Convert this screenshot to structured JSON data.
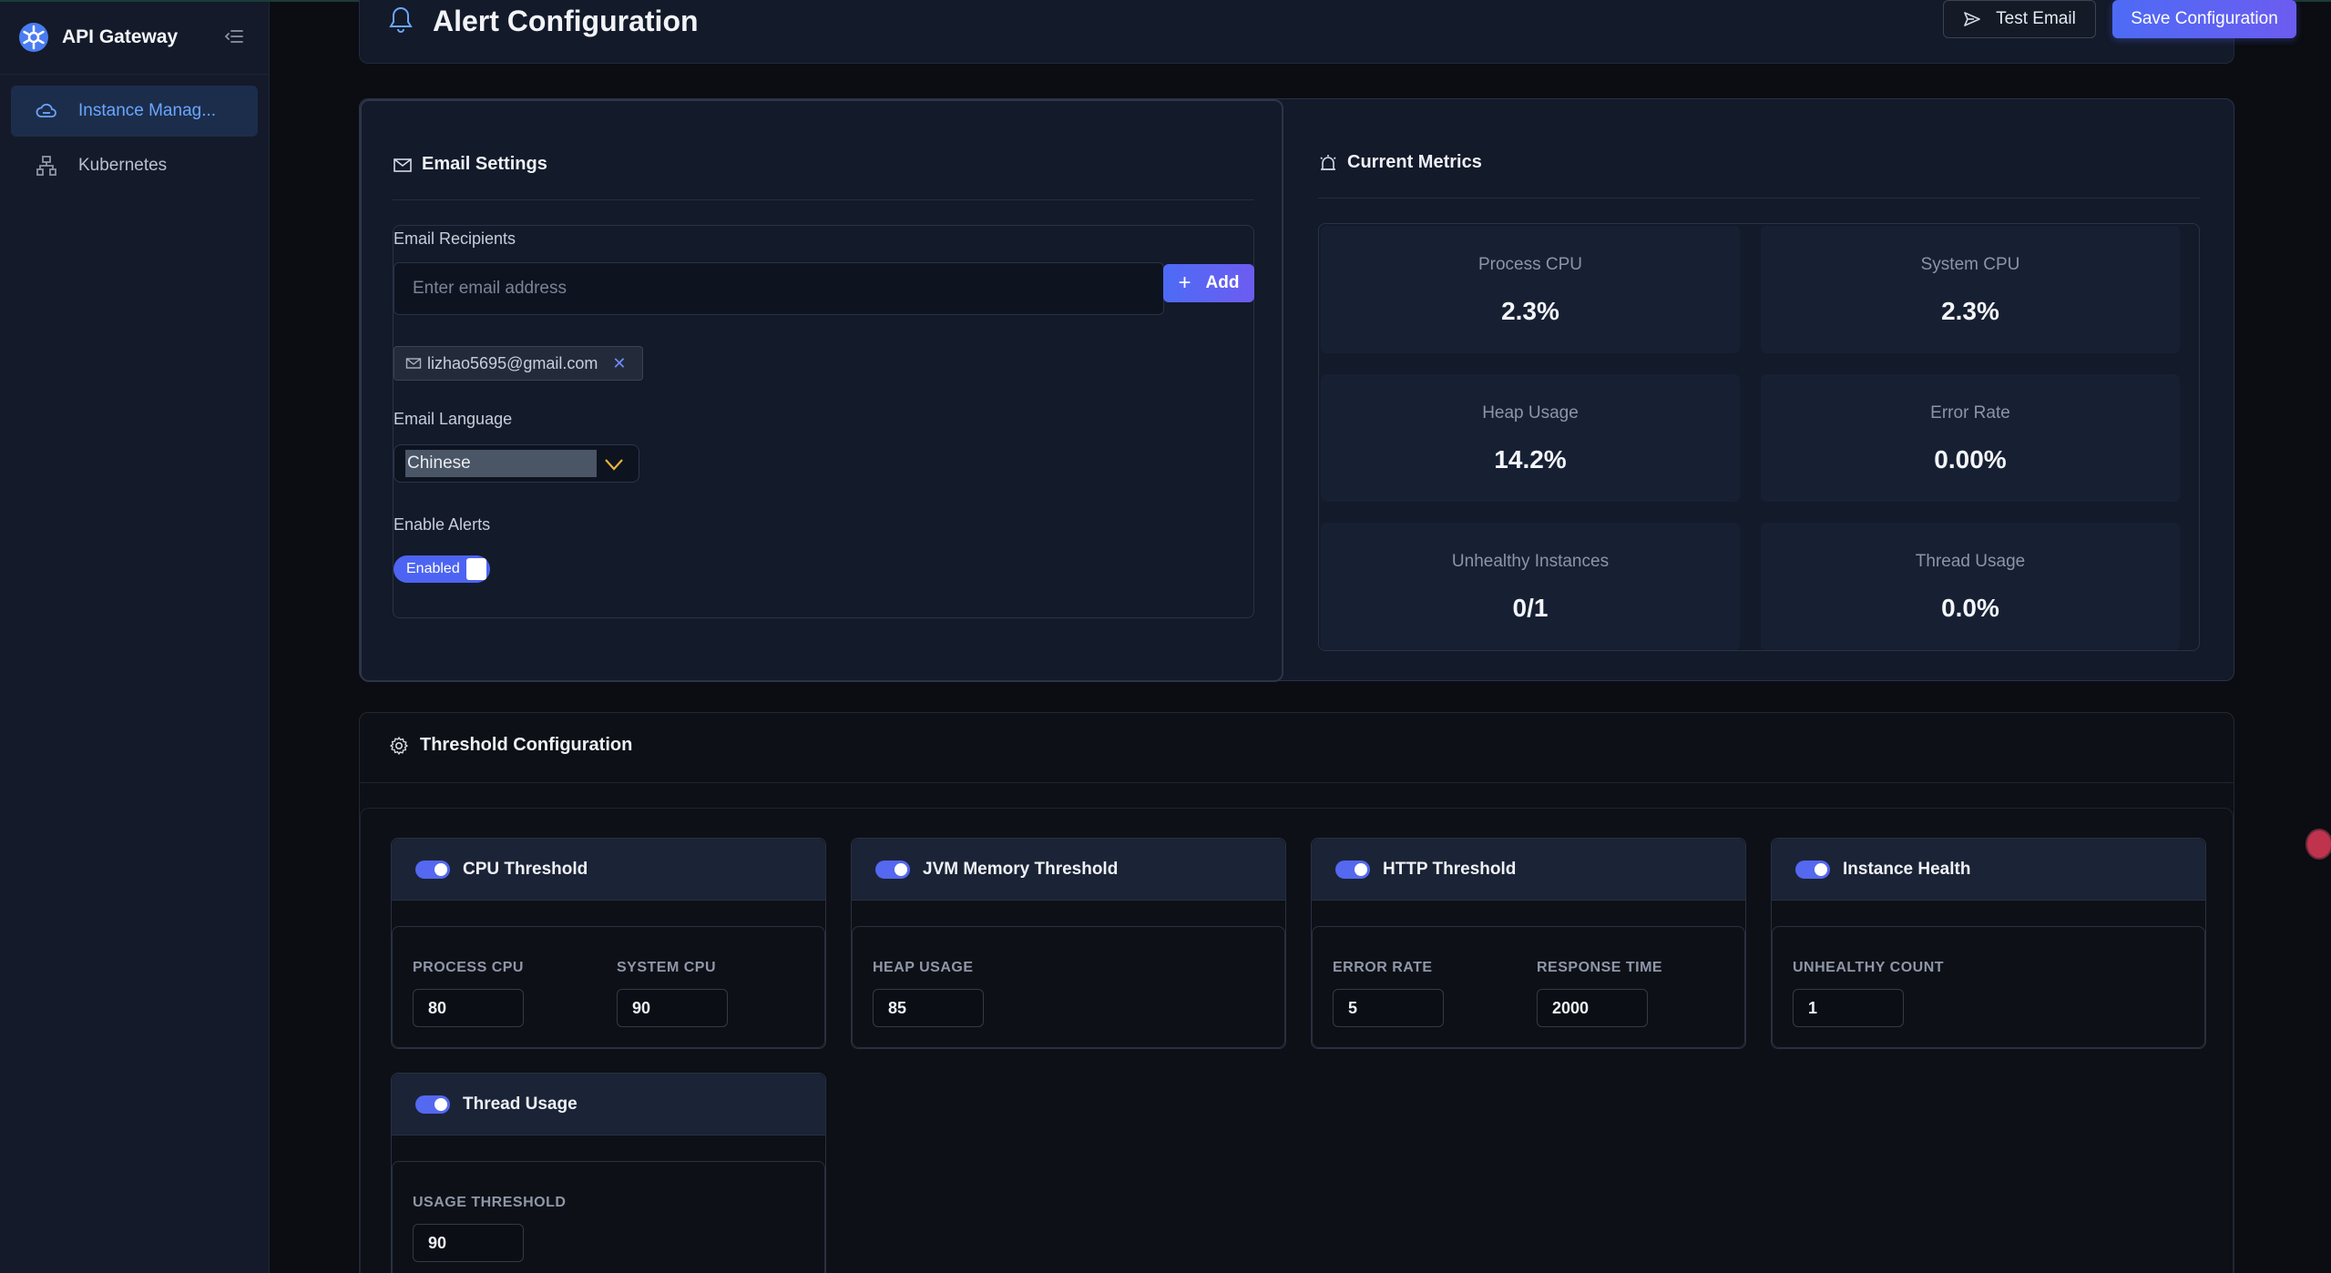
{
  "sidebar": {
    "brand": "API Gateway",
    "items": [
      {
        "label": "Instance Manag...",
        "icon": "cloud-icon",
        "active": true
      },
      {
        "label": "Kubernetes",
        "icon": "cluster-icon",
        "active": false
      }
    ]
  },
  "header": {
    "title": "Alert Configuration",
    "test_email_label": "Test Email",
    "save_label": "Save Configuration"
  },
  "email_settings": {
    "title": "Email Settings",
    "recipients_label": "Email Recipients",
    "input_placeholder": "Enter email address",
    "input_value": "",
    "add_label": "Add",
    "recipients": [
      "lizhao5695@gmail.com"
    ],
    "language_label": "Email Language",
    "language_value": "Chinese",
    "alerts_label": "Enable Alerts",
    "alerts_state": "Enabled"
  },
  "metrics": {
    "title": "Current Metrics",
    "items": [
      {
        "label": "Process CPU",
        "value": "2.3%"
      },
      {
        "label": "System CPU",
        "value": "2.3%"
      },
      {
        "label": "Heap Usage",
        "value": "14.2%"
      },
      {
        "label": "Error Rate",
        "value": "0.00%"
      },
      {
        "label": "Unhealthy Instances",
        "value": "0/1"
      },
      {
        "label": "Thread Usage",
        "value": "0.0%"
      }
    ]
  },
  "thresholds": {
    "title": "Threshold Configuration",
    "cards": [
      {
        "title": "CPU Threshold",
        "enabled": true,
        "fields": [
          {
            "label": "PROCESS CPU",
            "value": "80"
          },
          {
            "label": "SYSTEM CPU",
            "value": "90"
          }
        ]
      },
      {
        "title": "JVM Memory Threshold",
        "enabled": true,
        "fields": [
          {
            "label": "HEAP USAGE",
            "value": "85"
          }
        ]
      },
      {
        "title": "HTTP Threshold",
        "enabled": true,
        "fields": [
          {
            "label": "ERROR RATE",
            "value": "5"
          },
          {
            "label": "RESPONSE TIME",
            "value": "2000"
          }
        ]
      },
      {
        "title": "Instance Health",
        "enabled": true,
        "fields": [
          {
            "label": "UNHEALTHY COUNT",
            "value": "1"
          }
        ]
      },
      {
        "title": "Thread Usage",
        "enabled": true,
        "fields": [
          {
            "label": "USAGE THRESHOLD",
            "value": "90"
          }
        ]
      }
    ]
  },
  "colors": {
    "accent": "#4d6bf5",
    "sidebar_bg": "#141a29",
    "panel_bg": "#131a2a",
    "active_nav": "#6aa6ff"
  }
}
